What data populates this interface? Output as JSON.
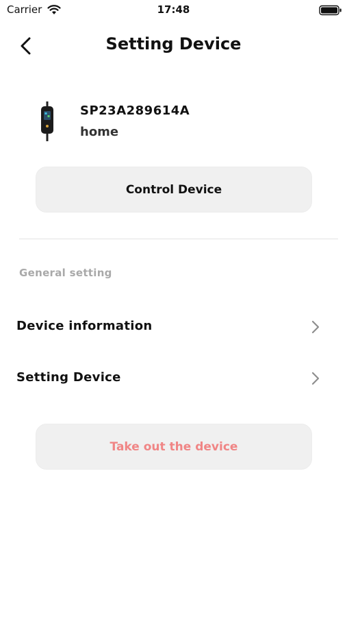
{
  "status_bar": {
    "carrier": "Carrier",
    "time": "17:48",
    "wifi_icon": "wifi-icon",
    "battery_icon": "battery-icon"
  },
  "nav": {
    "back_icon": "chevron-left-icon",
    "title": "Setting Device"
  },
  "device": {
    "serial": "SP23A289614A",
    "location": "home",
    "image_icon": "ev-charger-icon"
  },
  "actions": {
    "control_label": "Control Device",
    "takeout_label": "Take out the device"
  },
  "general_setting": {
    "header": "General setting",
    "items": [
      {
        "label": "Device information",
        "icon": "chevron-right-icon"
      },
      {
        "label": "Setting Device",
        "icon": "chevron-right-icon"
      }
    ]
  },
  "colors": {
    "button_background": "#f0f0f0",
    "danger_text": "#f08585",
    "section_header": "#a9a9a9",
    "divider": "#e3e3e3"
  }
}
